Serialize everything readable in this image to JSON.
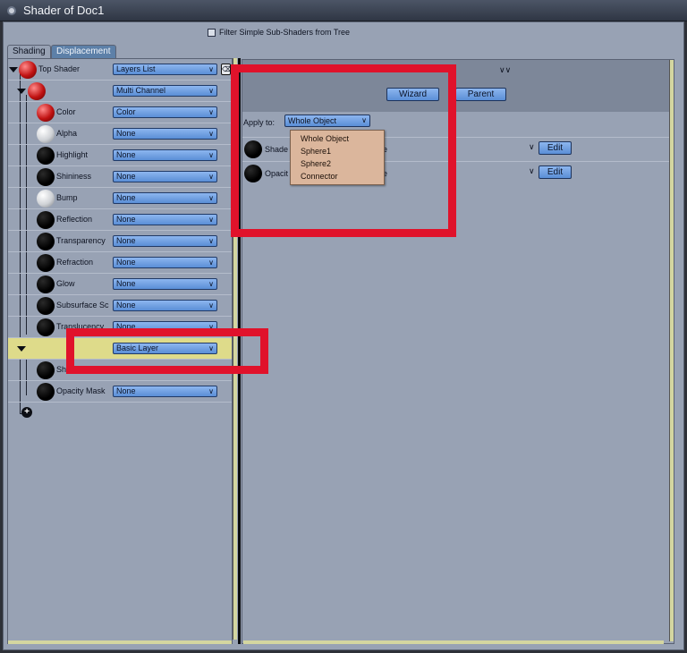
{
  "window": {
    "title": "Shader of Doc1"
  },
  "filter": {
    "label": "Filter Simple Sub-Shaders from Tree"
  },
  "tabs": [
    {
      "label": "Shading"
    },
    {
      "label": "Displacement"
    }
  ],
  "tree": {
    "top": {
      "label": "Top Shader",
      "value": "Layers List"
    },
    "multi": {
      "value": "Multi Channel"
    },
    "channels": [
      {
        "label": "Color",
        "value": "Color"
      },
      {
        "label": "Alpha",
        "value": "None"
      },
      {
        "label": "Highlight",
        "value": "None"
      },
      {
        "label": "Shininess",
        "value": "None"
      },
      {
        "label": "Bump",
        "value": "None"
      },
      {
        "label": "Reflection",
        "value": "None"
      },
      {
        "label": "Transparency",
        "value": "None"
      },
      {
        "label": "Refraction",
        "value": "None"
      },
      {
        "label": "Glow",
        "value": "None"
      },
      {
        "label": "Subsurface Sc",
        "value": "None"
      },
      {
        "label": "Translucency",
        "value": "None"
      }
    ],
    "basic_layer": {
      "value": "Basic Layer"
    },
    "layer_children": [
      {
        "label": "Sh",
        "value": ""
      },
      {
        "label": "Opacity Mask",
        "value": "None"
      }
    ]
  },
  "right": {
    "wizard_label": "Wizard",
    "parent_label": "Parent",
    "apply_label": "Apply to:",
    "apply_value": "Whole Object",
    "rows": [
      {
        "label": "Shade",
        "trailing": "e",
        "edit": "Edit"
      },
      {
        "label": "Opacit",
        "trailing": "e",
        "edit": "Edit"
      }
    ]
  },
  "apply_options": [
    "Whole Object",
    "Sphere1",
    "Sphere2",
    "Connector"
  ]
}
